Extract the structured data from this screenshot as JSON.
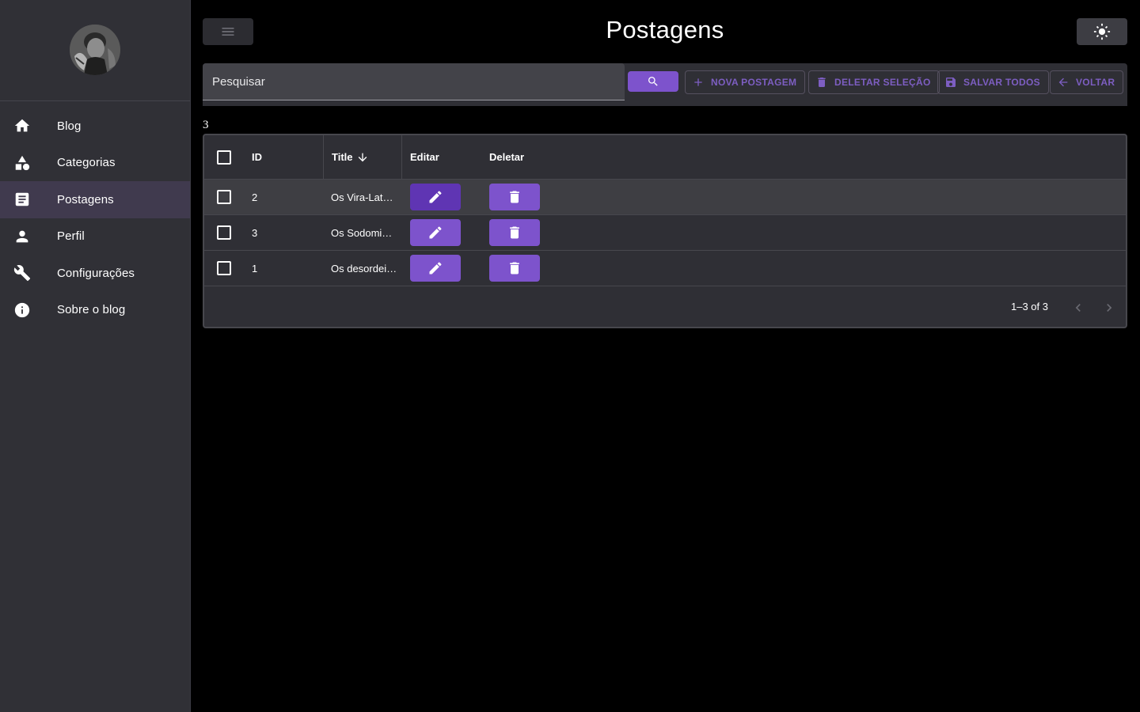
{
  "sidebar": {
    "items": [
      {
        "label": "Blog",
        "icon": "home-icon"
      },
      {
        "label": "Categorias",
        "icon": "category-icon"
      },
      {
        "label": "Postagens",
        "icon": "article-icon",
        "active": true
      },
      {
        "label": "Perfil",
        "icon": "person-icon"
      },
      {
        "label": "Configurações",
        "icon": "wrench-icon"
      },
      {
        "label": "Sobre o blog",
        "icon": "info-icon"
      }
    ]
  },
  "header": {
    "title": "Postagens"
  },
  "toolbar": {
    "search_placeholder": "Pesquisar",
    "new_label": "NOVA POSTAGEM",
    "delete_label": "DELETAR SELEÇÃO",
    "save_label": "SALVAR TODOS",
    "back_label": "VOLTAR"
  },
  "count": "3",
  "table": {
    "columns": {
      "id": "ID",
      "title": "Title",
      "edit": "Editar",
      "delete": "Deletar"
    },
    "rows": [
      {
        "id": "2",
        "title": "Os Vira-Lat…"
      },
      {
        "id": "3",
        "title": "Os Sodomi…"
      },
      {
        "id": "1",
        "title": "Os desordei…"
      }
    ],
    "pagination": "1–3 of 3"
  },
  "colors": {
    "accent": "#7d53cc",
    "accent_dark": "#5f35b3",
    "sidebar_bg": "#303036",
    "active_item_bg": "#403a4e",
    "background": "#000000"
  }
}
